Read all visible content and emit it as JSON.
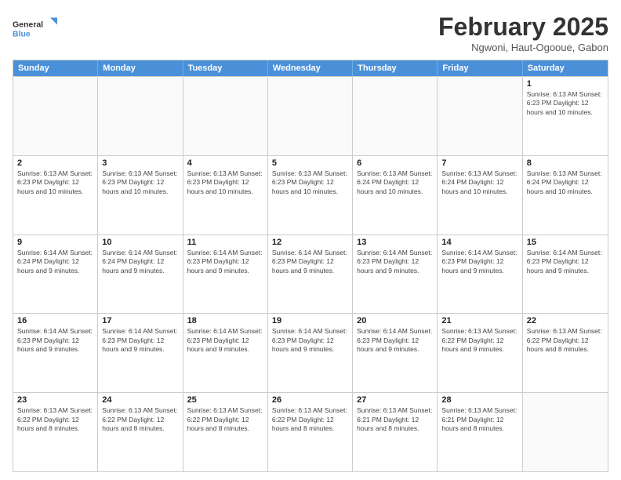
{
  "header": {
    "logo_line1": "General",
    "logo_line2": "Blue",
    "title": "February 2025",
    "subtitle": "Ngwoni, Haut-Ogooue, Gabon"
  },
  "weekdays": [
    "Sunday",
    "Monday",
    "Tuesday",
    "Wednesday",
    "Thursday",
    "Friday",
    "Saturday"
  ],
  "weeks": [
    [
      {
        "day": "",
        "info": ""
      },
      {
        "day": "",
        "info": ""
      },
      {
        "day": "",
        "info": ""
      },
      {
        "day": "",
        "info": ""
      },
      {
        "day": "",
        "info": ""
      },
      {
        "day": "",
        "info": ""
      },
      {
        "day": "1",
        "info": "Sunrise: 6:13 AM\nSunset: 6:23 PM\nDaylight: 12 hours\nand 10 minutes."
      }
    ],
    [
      {
        "day": "2",
        "info": "Sunrise: 6:13 AM\nSunset: 6:23 PM\nDaylight: 12 hours\nand 10 minutes."
      },
      {
        "day": "3",
        "info": "Sunrise: 6:13 AM\nSunset: 6:23 PM\nDaylight: 12 hours\nand 10 minutes."
      },
      {
        "day": "4",
        "info": "Sunrise: 6:13 AM\nSunset: 6:23 PM\nDaylight: 12 hours\nand 10 minutes."
      },
      {
        "day": "5",
        "info": "Sunrise: 6:13 AM\nSunset: 6:23 PM\nDaylight: 12 hours\nand 10 minutes."
      },
      {
        "day": "6",
        "info": "Sunrise: 6:13 AM\nSunset: 6:24 PM\nDaylight: 12 hours\nand 10 minutes."
      },
      {
        "day": "7",
        "info": "Sunrise: 6:13 AM\nSunset: 6:24 PM\nDaylight: 12 hours\nand 10 minutes."
      },
      {
        "day": "8",
        "info": "Sunrise: 6:13 AM\nSunset: 6:24 PM\nDaylight: 12 hours\nand 10 minutes."
      }
    ],
    [
      {
        "day": "9",
        "info": "Sunrise: 6:14 AM\nSunset: 6:24 PM\nDaylight: 12 hours\nand 9 minutes."
      },
      {
        "day": "10",
        "info": "Sunrise: 6:14 AM\nSunset: 6:24 PM\nDaylight: 12 hours\nand 9 minutes."
      },
      {
        "day": "11",
        "info": "Sunrise: 6:14 AM\nSunset: 6:23 PM\nDaylight: 12 hours\nand 9 minutes."
      },
      {
        "day": "12",
        "info": "Sunrise: 6:14 AM\nSunset: 6:23 PM\nDaylight: 12 hours\nand 9 minutes."
      },
      {
        "day": "13",
        "info": "Sunrise: 6:14 AM\nSunset: 6:23 PM\nDaylight: 12 hours\nand 9 minutes."
      },
      {
        "day": "14",
        "info": "Sunrise: 6:14 AM\nSunset: 6:23 PM\nDaylight: 12 hours\nand 9 minutes."
      },
      {
        "day": "15",
        "info": "Sunrise: 6:14 AM\nSunset: 6:23 PM\nDaylight: 12 hours\nand 9 minutes."
      }
    ],
    [
      {
        "day": "16",
        "info": "Sunrise: 6:14 AM\nSunset: 6:23 PM\nDaylight: 12 hours\nand 9 minutes."
      },
      {
        "day": "17",
        "info": "Sunrise: 6:14 AM\nSunset: 6:23 PM\nDaylight: 12 hours\nand 9 minutes."
      },
      {
        "day": "18",
        "info": "Sunrise: 6:14 AM\nSunset: 6:23 PM\nDaylight: 12 hours\nand 9 minutes."
      },
      {
        "day": "19",
        "info": "Sunrise: 6:14 AM\nSunset: 6:23 PM\nDaylight: 12 hours\nand 9 minutes."
      },
      {
        "day": "20",
        "info": "Sunrise: 6:14 AM\nSunset: 6:23 PM\nDaylight: 12 hours\nand 9 minutes."
      },
      {
        "day": "21",
        "info": "Sunrise: 6:13 AM\nSunset: 6:22 PM\nDaylight: 12 hours\nand 9 minutes."
      },
      {
        "day": "22",
        "info": "Sunrise: 6:13 AM\nSunset: 6:22 PM\nDaylight: 12 hours\nand 8 minutes."
      }
    ],
    [
      {
        "day": "23",
        "info": "Sunrise: 6:13 AM\nSunset: 6:22 PM\nDaylight: 12 hours\nand 8 minutes."
      },
      {
        "day": "24",
        "info": "Sunrise: 6:13 AM\nSunset: 6:22 PM\nDaylight: 12 hours\nand 8 minutes."
      },
      {
        "day": "25",
        "info": "Sunrise: 6:13 AM\nSunset: 6:22 PM\nDaylight: 12 hours\nand 8 minutes."
      },
      {
        "day": "26",
        "info": "Sunrise: 6:13 AM\nSunset: 6:22 PM\nDaylight: 12 hours\nand 8 minutes."
      },
      {
        "day": "27",
        "info": "Sunrise: 6:13 AM\nSunset: 6:21 PM\nDaylight: 12 hours\nand 8 minutes."
      },
      {
        "day": "28",
        "info": "Sunrise: 6:13 AM\nSunset: 6:21 PM\nDaylight: 12 hours\nand 8 minutes."
      },
      {
        "day": "",
        "info": ""
      }
    ]
  ]
}
